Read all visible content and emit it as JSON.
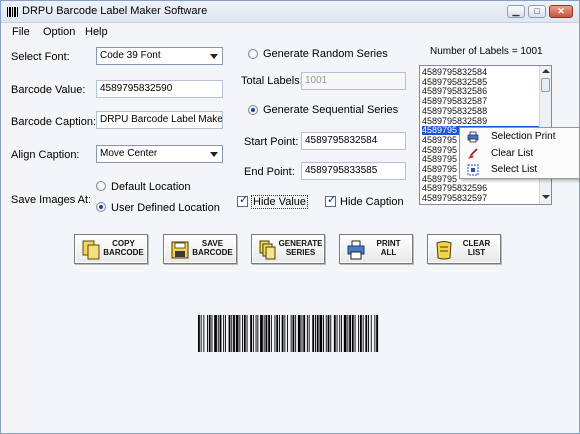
{
  "window": {
    "title": "DRPU Barcode Label Maker Software",
    "buttons": {
      "minimize": "▁",
      "maximize": "□",
      "close": "✕"
    }
  },
  "menu": {
    "items": [
      "File",
      "Option",
      "Help"
    ]
  },
  "form": {
    "select_font_label": "Select Font:",
    "select_font_value": "Code 39 Font",
    "barcode_value_label": "Barcode Value:",
    "barcode_value": "4589795832590",
    "barcode_caption_label": "Barcode Caption:",
    "barcode_caption_value": "DRPU Barcode Label Maker",
    "align_caption_label": "Align Caption:",
    "align_caption_value": "Move Center",
    "save_images_label": "Save Images At:",
    "default_location": "Default Location",
    "user_defined_location": "User Defined Location",
    "hide_value": "Hide Value",
    "hide_caption": "Hide Caption"
  },
  "series": {
    "random_label": "Generate Random Series",
    "total_labels_label": "Total Labels:",
    "total_labels_value": "1001",
    "sequential_label": "Generate Sequential Series",
    "start_point_label": "Start Point:",
    "start_point_value": "4589795832584",
    "end_point_label": "End Point:",
    "end_point_value": "4589795833585"
  },
  "list": {
    "count_label": "Number of Labels = 1001",
    "items": [
      "4589795832584",
      "4589795832585",
      "4589795832586",
      "4589795832587",
      "4589795832588",
      "4589795832589",
      "4589795",
      "4589795",
      "4589795",
      "4589795",
      "4589795",
      "4589795",
      "4589795832596",
      "4589795832597"
    ]
  },
  "context_menu": {
    "items": [
      "Selection Print",
      "Clear List",
      "Select List"
    ]
  },
  "toolbar": {
    "copy": "COPY\nBARCODE",
    "save": "SAVE\nBARCODE",
    "generate": "GENERATE\nSERIES",
    "print": "PRINT\nALL",
    "clear": "CLEAR\nLIST"
  },
  "colors": {
    "selection": "#1d55d6",
    "window_background": "#f3f5f9"
  }
}
